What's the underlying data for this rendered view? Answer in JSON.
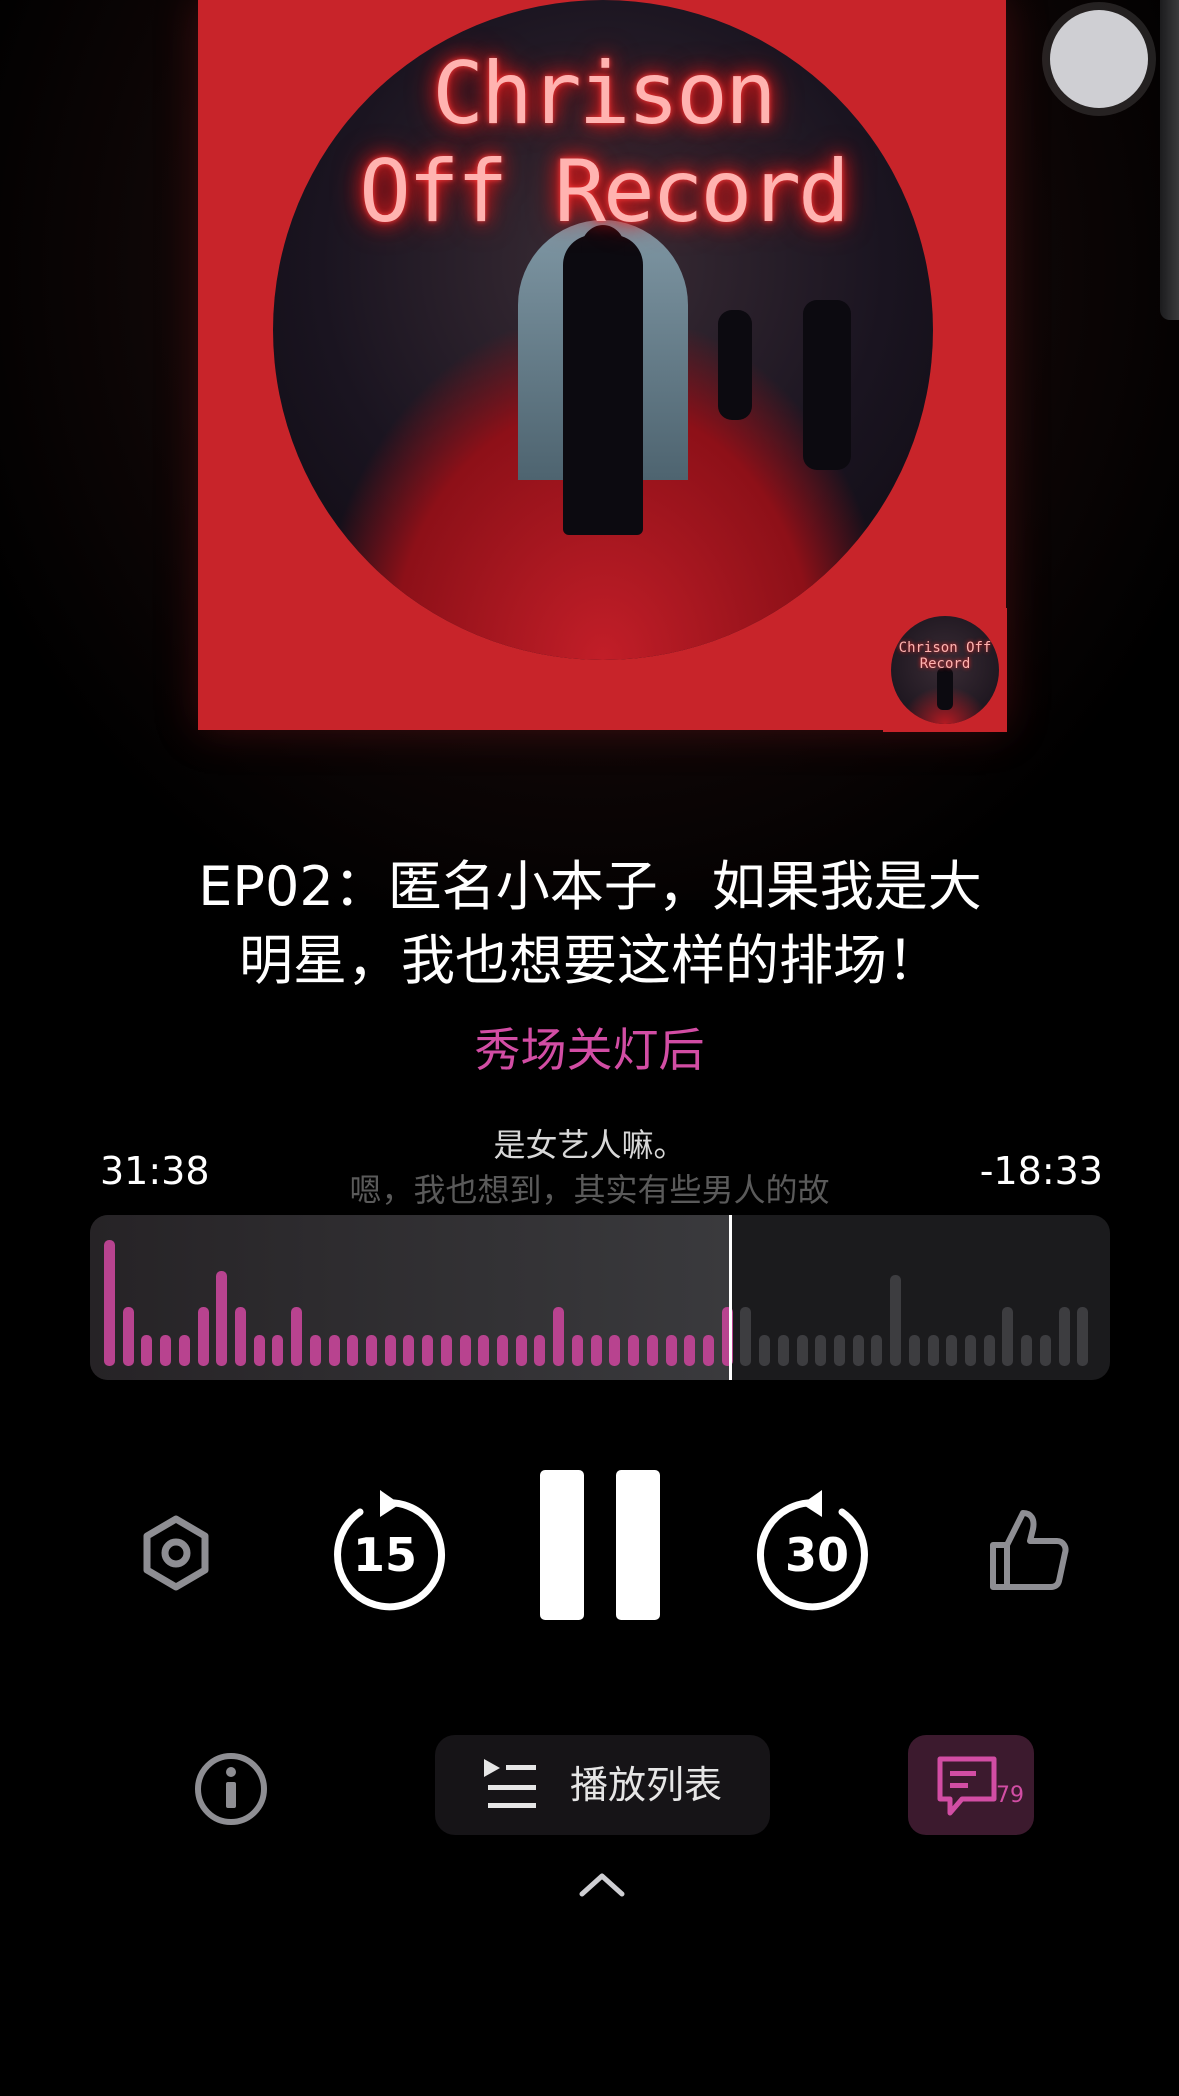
{
  "artwork": {
    "title_line1": "Chrison",
    "title_line2": "Off Record",
    "thumb_title": "Chrison Off Record"
  },
  "episode": {
    "title_line1": "EP02：匿名小本子，如果我是大",
    "title_line2": "明星，我也想要这样的排场！",
    "show_name": "秀场关灯后"
  },
  "lyrics": {
    "current": "是女艺人嘛。",
    "next": "嗯，我也想到，其实有些男人的故"
  },
  "player": {
    "elapsed": "31:38",
    "remaining": "-18:33",
    "progress_fraction": 0.63,
    "rewind_seconds": "15",
    "forward_seconds": "30",
    "state": "playing"
  },
  "waveform": {
    "levels": [
      0.9,
      0.42,
      0.22,
      0.22,
      0.22,
      0.42,
      0.68,
      0.42,
      0.22,
      0.22,
      0.42,
      0.22,
      0.22,
      0.22,
      0.22,
      0.22,
      0.22,
      0.22,
      0.22,
      0.22,
      0.22,
      0.22,
      0.22,
      0.22,
      0.42,
      0.22,
      0.22,
      0.22,
      0.22,
      0.22,
      0.22,
      0.22,
      0.22,
      0.42,
      0.42,
      0.22,
      0.22,
      0.22,
      0.22,
      0.22,
      0.22,
      0.22,
      0.65,
      0.22,
      0.22,
      0.22,
      0.22,
      0.22,
      0.42,
      0.22,
      0.22,
      0.42,
      0.42
    ],
    "played_color": "#b8438f",
    "unplayed_color": "#3d3d40"
  },
  "bottom_bar": {
    "playlist_label": "播放列表",
    "comment_count": "79"
  },
  "colors": {
    "accent": "#d24da4",
    "cover_red": "#c8242a",
    "background": "#000000"
  },
  "icons": {
    "settings": "hexagon-settings-icon",
    "rewind": "rewind-15-icon",
    "pause": "pause-icon",
    "forward": "forward-30-icon",
    "like": "thumbs-up-icon",
    "info": "info-icon",
    "playlist": "playlist-icon",
    "comment": "comment-icon",
    "expand": "chevron-up-icon"
  }
}
